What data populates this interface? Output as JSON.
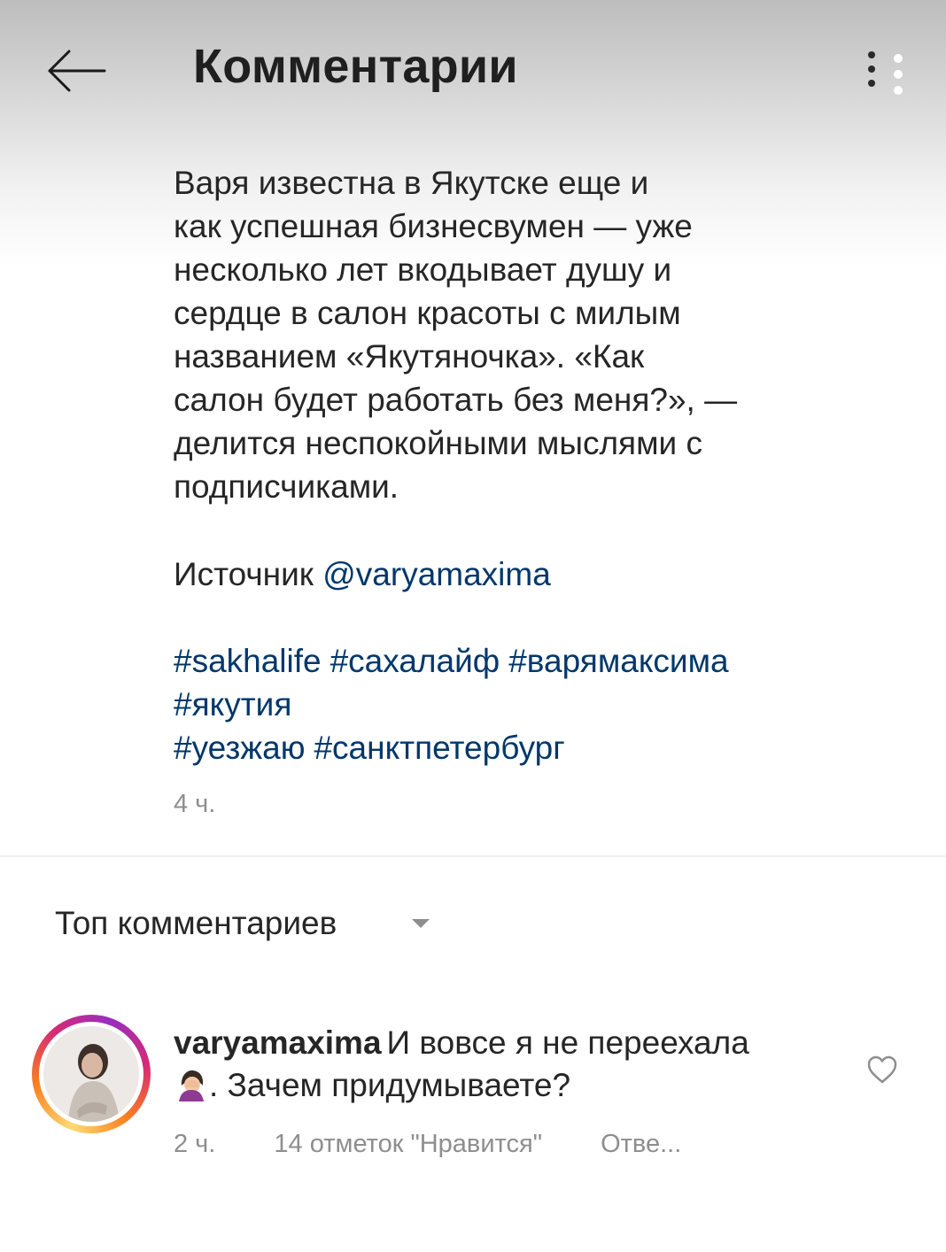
{
  "header": {
    "title": "Комментарии",
    "back_icon": "arrow-left-icon",
    "more_icon": "more-vertical-icon"
  },
  "post": {
    "caption_lines": [
      "Варя известна в Якутске еще и",
      "как успешная бизнесвумен — уже",
      "несколько лет вкодывает душу и",
      "сердце в салон красоты с милым",
      "названием «Якутяночка». «Как",
      "салон будет работать без меня?», —",
      "делится неспокойными мыслями с",
      "подписчиками."
    ],
    "source_label": "Источник",
    "source_mention": "@varyamaxima",
    "hashtag_lines": [
      [
        "#sakhalife",
        "#сахалайф",
        "#варямаксима"
      ],
      [
        "#якутия"
      ],
      [
        "#уезжаю",
        "#санктпетербург"
      ]
    ],
    "time": "4 ч."
  },
  "sort": {
    "label": "Топ комментариев",
    "caret_icon": "caret-down-icon"
  },
  "comments": [
    {
      "username": "varyamaxima",
      "text_line1": "И вовсе я не переехала",
      "emoji": "woman-facepalming-emoji",
      "text_line2": ". Зачем придумываете?",
      "time": "2 ч.",
      "likes": "14 отметок \"Нравится\"",
      "reply": "Отве...",
      "like_icon": "heart-outline-icon"
    }
  ],
  "colors": {
    "text": "#262626",
    "link": "#00376b",
    "secondary": "#8e8e8e",
    "divider": "#efefef"
  }
}
